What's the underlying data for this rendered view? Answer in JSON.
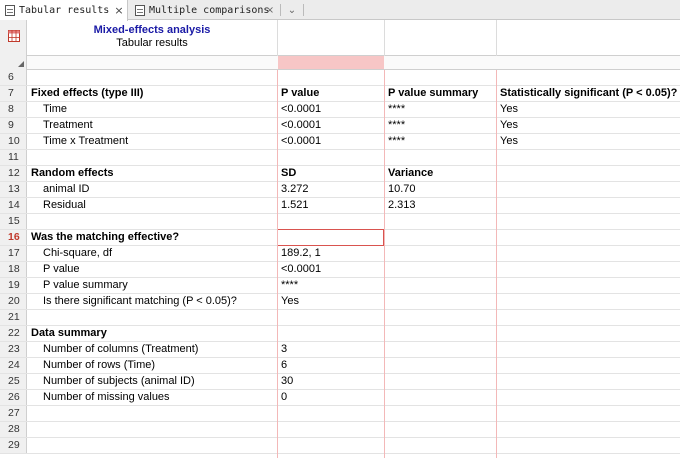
{
  "tabs": [
    {
      "label": "Tabular results",
      "active": true
    },
    {
      "label": "Multiple comparisons",
      "active": false
    }
  ],
  "sheet": {
    "title": "Mixed-effects analysis",
    "subtitle": "Tabular results"
  },
  "rows": [
    {
      "n": "6",
      "a": "",
      "b": "",
      "c": "",
      "d": ""
    },
    {
      "n": "7",
      "a": "Fixed effects (type III)",
      "b": "P value",
      "c": "P value summary",
      "d": "Statistically significant (P < 0.05)?",
      "header": true
    },
    {
      "n": "8",
      "a": "Time",
      "b": "<0.0001",
      "c": "****",
      "d": "Yes",
      "indent": true
    },
    {
      "n": "9",
      "a": "Treatment",
      "b": "<0.0001",
      "c": "****",
      "d": "Yes",
      "indent": true
    },
    {
      "n": "10",
      "a": "Time x Treatment",
      "b": "<0.0001",
      "c": "****",
      "d": "Yes",
      "indent": true
    },
    {
      "n": "11",
      "a": "",
      "b": "",
      "c": "",
      "d": ""
    },
    {
      "n": "12",
      "a": "Random effects",
      "b": "SD",
      "c": "Variance",
      "d": "",
      "header": true
    },
    {
      "n": "13",
      "a": "animal ID",
      "b": "3.272",
      "c": "10.70",
      "d": "",
      "indent": true
    },
    {
      "n": "14",
      "a": "Residual",
      "b": "1.521",
      "c": "2.313",
      "d": "",
      "indent": true
    },
    {
      "n": "15",
      "a": "",
      "b": "",
      "c": "",
      "d": ""
    },
    {
      "n": "16",
      "a": "Was the matching effective?",
      "b": "",
      "c": "",
      "d": "",
      "header": true,
      "selected": true
    },
    {
      "n": "17",
      "a": "Chi-square, df",
      "b": "189.2, 1",
      "c": "",
      "d": "",
      "indent": true
    },
    {
      "n": "18",
      "a": "P value",
      "b": "<0.0001",
      "c": "",
      "d": "",
      "indent": true
    },
    {
      "n": "19",
      "a": "P value summary",
      "b": "****",
      "c": "",
      "d": "",
      "indent": true
    },
    {
      "n": "20",
      "a": "Is there significant matching (P < 0.05)?",
      "b": "Yes",
      "c": "",
      "d": "",
      "indent": true
    },
    {
      "n": "21",
      "a": "",
      "b": "",
      "c": "",
      "d": ""
    },
    {
      "n": "22",
      "a": "Data summary",
      "b": "",
      "c": "",
      "d": "",
      "header": true
    },
    {
      "n": "23",
      "a": "Number of columns (Treatment)",
      "b": "3",
      "c": "",
      "d": "",
      "indent": true
    },
    {
      "n": "24",
      "a": "Number of rows (Time)",
      "b": "6",
      "c": "",
      "d": "",
      "indent": true
    },
    {
      "n": "25",
      "a": "Number of subjects (animal ID)",
      "b": "30",
      "c": "",
      "d": "",
      "indent": true
    },
    {
      "n": "26",
      "a": "Number of missing values",
      "b": "0",
      "c": "",
      "d": "",
      "indent": true
    },
    {
      "n": "27",
      "a": "",
      "b": "",
      "c": "",
      "d": ""
    },
    {
      "n": "28",
      "a": "",
      "b": "",
      "c": "",
      "d": ""
    },
    {
      "n": "29",
      "a": "",
      "b": "",
      "c": "",
      "d": ""
    }
  ],
  "colors": {
    "accent": "#1a1aa6",
    "selection": "#d9534f",
    "highlight": "#f7c6c6"
  }
}
